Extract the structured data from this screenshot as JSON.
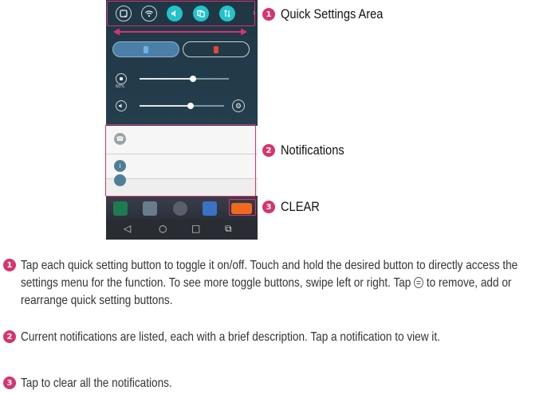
{
  "callouts": [
    {
      "num": "1",
      "label": "Quick Settings Area"
    },
    {
      "num": "2",
      "label": "Notifications"
    },
    {
      "num": "3",
      "label": "CLEAR"
    }
  ],
  "phone": {
    "quick_settings": [
      {
        "icon": "screenshot-icon",
        "state": "off"
      },
      {
        "icon": "wifi-icon",
        "state": "off"
      },
      {
        "icon": "sound-icon",
        "state": "on"
      },
      {
        "icon": "sim-card-icon",
        "state": "on"
      },
      {
        "icon": "data-icon",
        "state": "on"
      }
    ],
    "sim_cards": [
      {
        "color": "#6fb2e8",
        "active": true
      },
      {
        "color": "#e8443a",
        "active": false
      }
    ],
    "brightness_label": "60%",
    "brightness_level": 0.6,
    "volume_level": 0.6,
    "notifications": [
      {
        "icon": "phone-icon",
        "color": "#9aa4a8"
      },
      {
        "icon": "info-icon",
        "color": "#4f7f95"
      }
    ],
    "nav_keys": [
      "◁",
      "○",
      "□",
      "⧉"
    ]
  },
  "descriptions": [
    {
      "num": "1",
      "before_icon": "Tap each quick setting button to toggle it on/off. Touch and hold the desired button to directly access the settings menu for the function. To see more toggle buttons, swipe left or right. Tap ",
      "after_icon": " to remove, add or rearrange quick setting buttons."
    },
    {
      "num": "2",
      "text": "Current notifications are listed, each with a brief description. Tap a notification to view it."
    },
    {
      "num": "3",
      "text": "Tap to clear all the notifications."
    }
  ]
}
